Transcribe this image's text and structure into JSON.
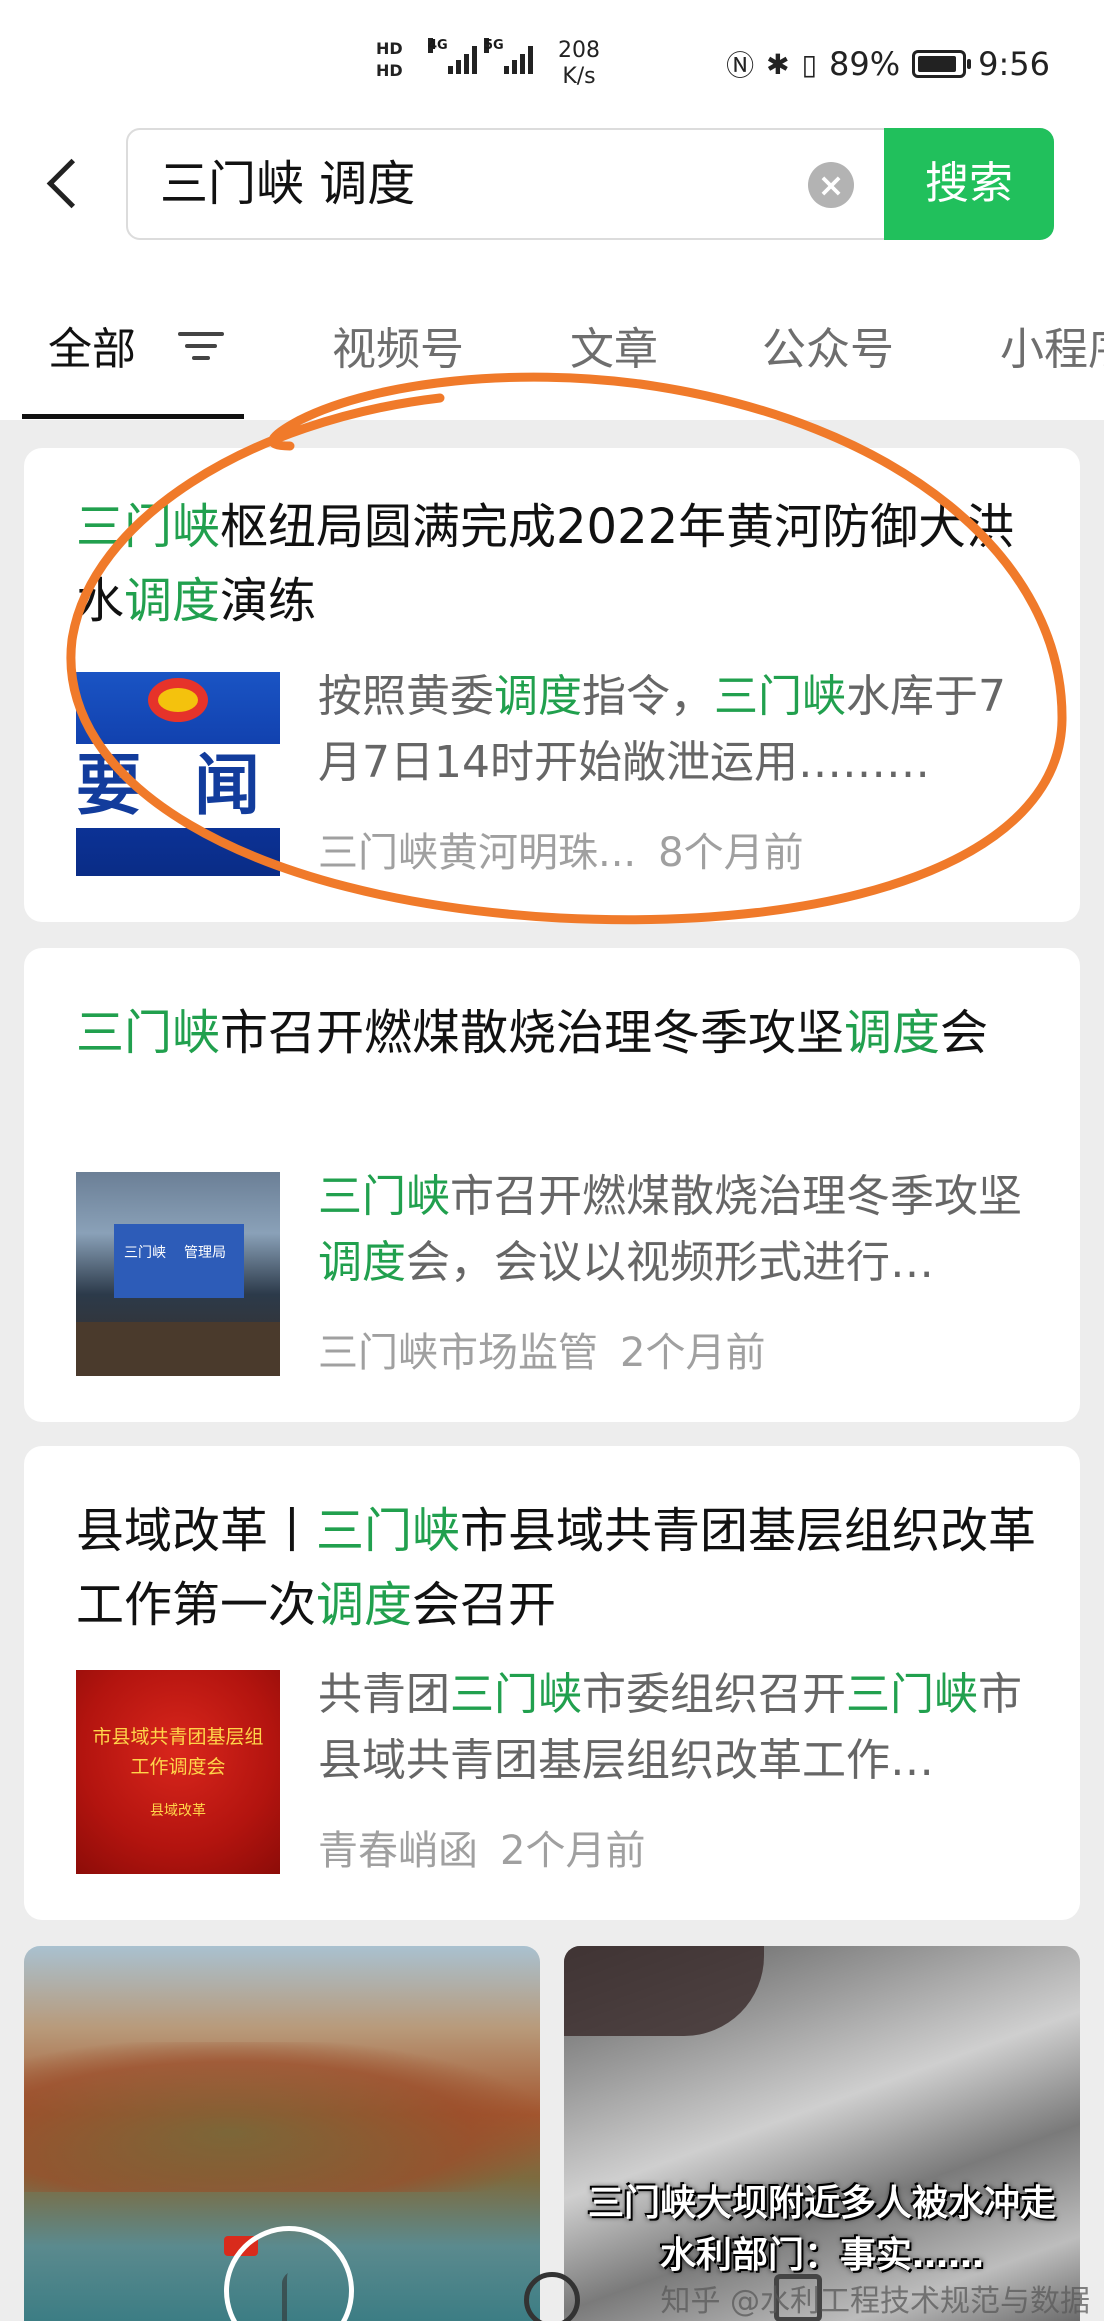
{
  "status_bar": {
    "hd1": "HD",
    "hd2": "HD",
    "net1": "4G",
    "net2": "5G",
    "speed_value": "208",
    "speed_unit": "K/s",
    "battery": "89%",
    "battery_level": 0.89,
    "time": "9:56"
  },
  "search": {
    "query": "三门峡 调度",
    "button_label": "搜索"
  },
  "tabs": [
    "全部",
    "视频号",
    "文章",
    "公众号",
    "小程序"
  ],
  "results": [
    {
      "title_parts": [
        {
          "text": "三门峡",
          "hl": true
        },
        {
          "text": "枢纽局圆满完成2022年黄河防御大洪水",
          "hl": false
        },
        {
          "text": "调度",
          "hl": true
        },
        {
          "text": "演练",
          "hl": false
        }
      ],
      "desc_parts": [
        {
          "text": "按照黄委",
          "hl": false
        },
        {
          "text": "调度",
          "hl": true
        },
        {
          "text": "指令，",
          "hl": false
        },
        {
          "text": "三门峡",
          "hl": true
        },
        {
          "text": "水库于7月7日14时开始敞泄运用………",
          "hl": false
        }
      ],
      "source": "三门峡黄河明珠...",
      "time": "8个月前",
      "thumb_text": [
        "要",
        "闻"
      ]
    },
    {
      "title_parts": [
        {
          "text": "三门峡",
          "hl": true
        },
        {
          "text": "市召开燃煤散烧治理冬季攻坚",
          "hl": false
        },
        {
          "text": "调度",
          "hl": true
        },
        {
          "text": "会",
          "hl": false
        }
      ],
      "desc_parts": [
        {
          "text": "三门峡",
          "hl": true
        },
        {
          "text": "市召开燃煤散烧治理冬季攻坚",
          "hl": false
        },
        {
          "text": "调度",
          "hl": true
        },
        {
          "text": "会，会议以视频形式进行…",
          "hl": false
        }
      ],
      "source": "三门峡市场监管",
      "time": "2个月前",
      "thumb_text": [
        "三门峡",
        "管理局"
      ]
    },
    {
      "title_parts": [
        {
          "text": "县域改革丨",
          "hl": false
        },
        {
          "text": "三门峡",
          "hl": true
        },
        {
          "text": "市县域共青团基层组织改革工作第一次",
          "hl": false
        },
        {
          "text": "调度",
          "hl": true
        },
        {
          "text": "会召开",
          "hl": false
        }
      ],
      "desc_parts": [
        {
          "text": "共青团",
          "hl": false
        },
        {
          "text": "三门峡",
          "hl": true
        },
        {
          "text": "市委组织召开",
          "hl": false
        },
        {
          "text": "三门峡",
          "hl": true
        },
        {
          "text": "市县域共青团基层组织改革工作…",
          "hl": false
        }
      ],
      "source": "青春峭函",
      "time": "2个月前",
      "thumb_text": [
        "市县域共青团基层组",
        "工作调度会",
        "县域改革"
      ]
    }
  ],
  "video2_caption": [
    "三门峡大坝附近多人被水冲走",
    "水利部门：事实……"
  ],
  "watermark": "知乎 @水利工程技术规范与数据",
  "colors": {
    "accent_green": "#21c05c",
    "highlight_green": "#21a04e",
    "annotation_orange": "#f07a2a"
  }
}
